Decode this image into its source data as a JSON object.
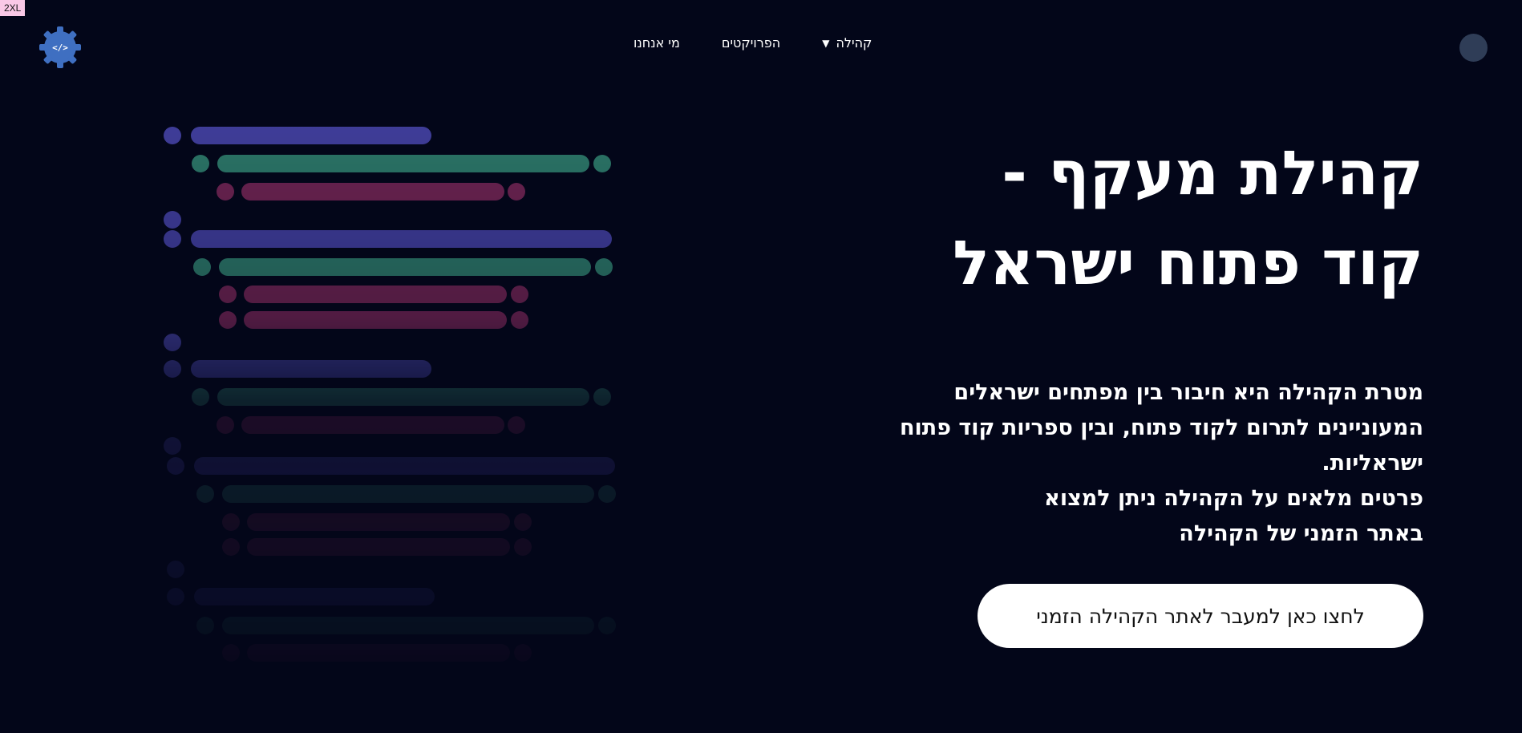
{
  "badge": "2XL",
  "logo": {
    "text": "</>",
    "color": "#3f6fc1"
  },
  "nav": {
    "items": [
      {
        "label": "קהילה",
        "has_dropdown": true
      },
      {
        "label": "הפרויקטים"
      },
      {
        "label": "מי אנחנו"
      }
    ]
  },
  "hero": {
    "title_line1": "קהילת מעקף -",
    "title_line2": "קוד פתוח ישראל",
    "description": "מטרת הקהילה היא חיבור בין מפתחים ישראלים\nהמעוניינים לתרום לקוד פתוח, ובין ספריות קוד פתוח\nישראליות.\nפרטים מלאים על הקהילה ניתן למצוא\nבאתר הזמני של הקהילה",
    "cta_label": "לחצו כאן למעבר לאתר הקהילה הזמני"
  },
  "colors": {
    "background": "#030619",
    "purple": "#3f3d99",
    "teal": "#2b7466",
    "magenta": "#6b2350"
  }
}
